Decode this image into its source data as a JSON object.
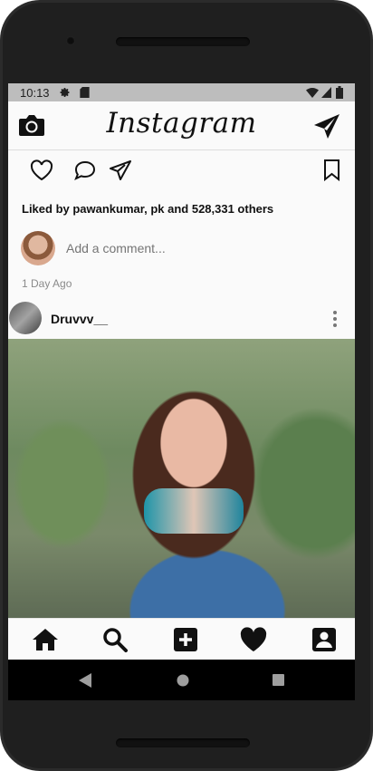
{
  "status_bar": {
    "time": "10:13"
  },
  "app_bar": {
    "title": "Instagram"
  },
  "post_meta": {
    "liked_by": "Liked by pawankumar, pk and 528,331 others",
    "comment_placeholder": "Add a comment...",
    "time_ago": "1 Day Ago"
  },
  "next_post": {
    "username": "Druvvv__"
  },
  "icons": {
    "status": [
      "gear-icon",
      "sd-card-icon",
      "wifi-icon",
      "signal-icon",
      "battery-icon"
    ],
    "app_bar": [
      "camera-icon",
      "send-icon"
    ],
    "post_actions": [
      "heart-outline-icon",
      "comment-icon",
      "share-icon",
      "bookmark-icon"
    ],
    "tab_bar": [
      "home-icon",
      "search-icon",
      "add-icon",
      "heart-icon",
      "profile-icon"
    ],
    "nav_bar": [
      "back-icon",
      "home-circle-icon",
      "recents-icon"
    ]
  },
  "colors": {
    "status_bar_bg": "#bdbdbd",
    "app_bg": "#fafafa",
    "text_primary": "#111111",
    "text_secondary": "#8a8a8a",
    "nav_bar_bg": "#000000"
  }
}
